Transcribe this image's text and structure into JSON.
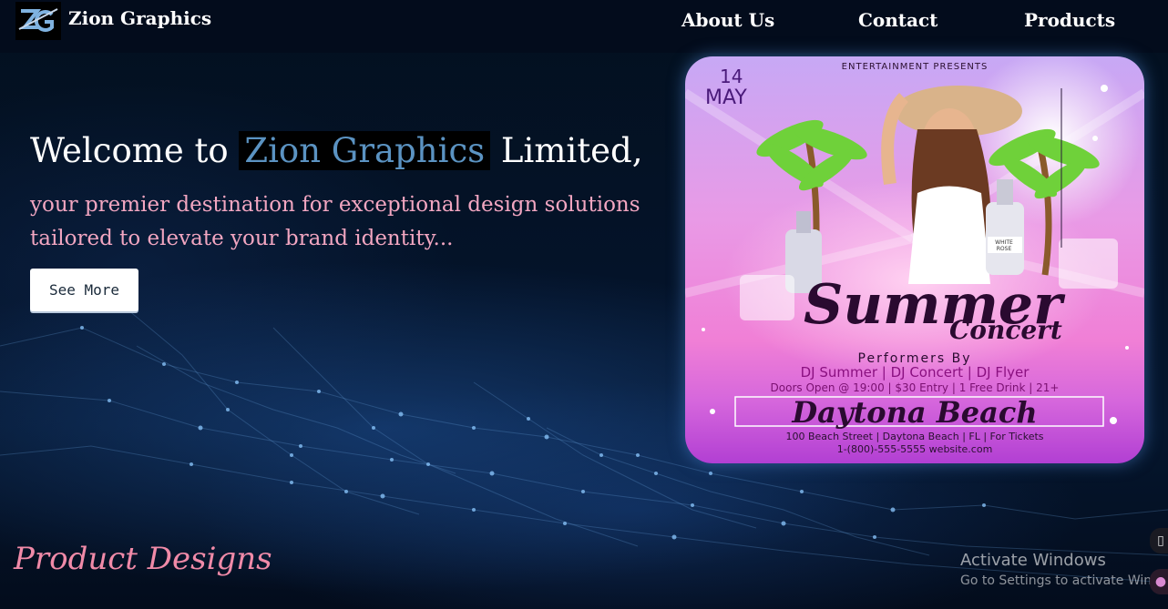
{
  "header": {
    "brand": "Zion Graphics",
    "logo_icon": "zion-logo-icon",
    "nav": [
      "About Us",
      "Contact",
      "Products"
    ]
  },
  "hero": {
    "title_before": "Welcome to ",
    "title_highlight": "Zion Graphics",
    "title_after": " Limited,",
    "subtitle": "your premier destination for exceptional design solutions tailored to elevate your brand identity...",
    "cta_label": "See More"
  },
  "poster": {
    "presenter": "ENTERTAINMENT PRESENTS",
    "day": "14",
    "month": "MAY",
    "title_main": "Summer",
    "title_sub": "Concert",
    "performers_heading": "Performers By",
    "performers": "DJ Summer | DJ Concert | DJ Flyer",
    "details": "Doors Open @ 19:00 | $30 Entry | 1 Free Drink | 21+",
    "venue": "Daytona Beach",
    "address": "100 Beach Street | Daytona Beach | FL | For Tickets",
    "contact": "1-(800)-555-5555 website.com",
    "bottle_label": "WHITE ROSE"
  },
  "section": {
    "product_designs": "Product Designs"
  },
  "watermark": {
    "title": "Activate Windows",
    "subtitle": "Go to Settings to activate Windo"
  },
  "colors": {
    "background": "#020a1a",
    "highlight_text": "#5b93c2",
    "subtitle_pink": "#f2a6c1",
    "product_pink": "#f08aa8"
  }
}
